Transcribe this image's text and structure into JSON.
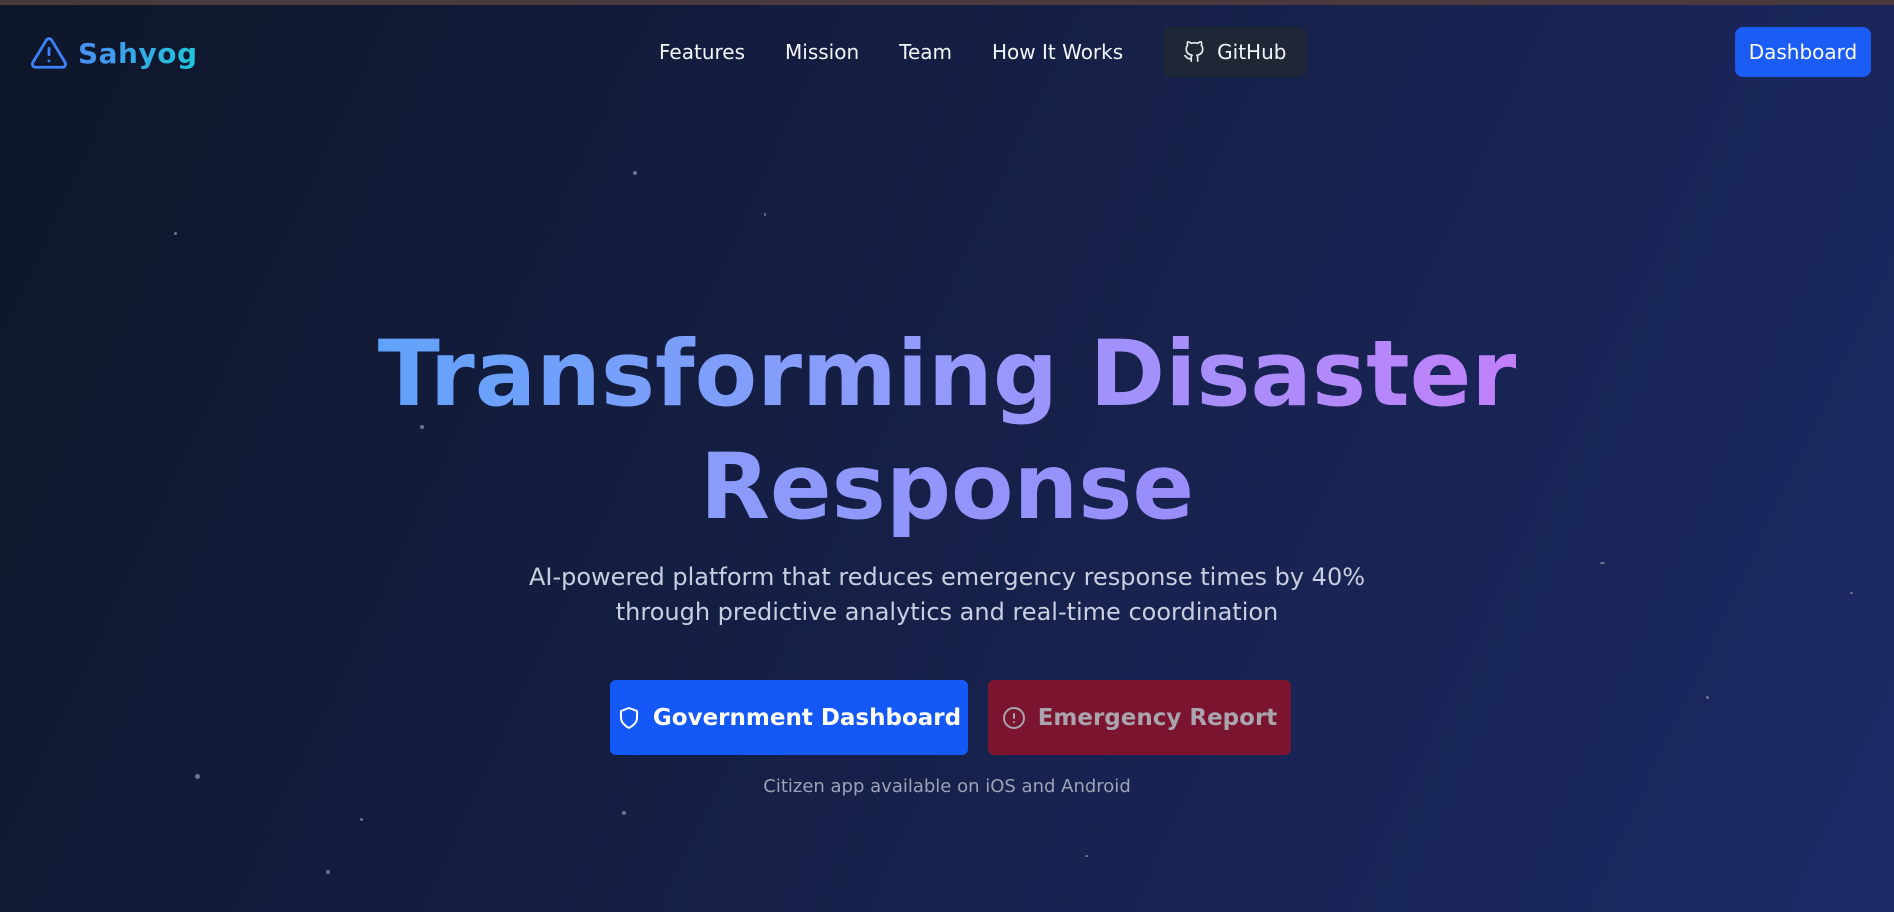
{
  "brand": {
    "name": "Sahyog",
    "icon": "warning-triangle-icon"
  },
  "nav": {
    "links": [
      "Features",
      "Mission",
      "Team",
      "How It Works"
    ],
    "github_label": "GitHub",
    "github_icon": "github-icon",
    "dashboard_label": "Dashboard"
  },
  "hero": {
    "title_line1": "Transforming Disaster",
    "title_line2": "Response",
    "subtitle_line1": "AI-powered platform that reduces emergency response times by 40%",
    "subtitle_line2": "through predictive analytics and real-time coordination",
    "primary_cta": "Government Dashboard",
    "primary_icon": "shield-icon",
    "secondary_cta": "Emergency Report",
    "secondary_icon": "alert-circle-icon",
    "note": "Citizen app available on iOS and Android"
  },
  "colors": {
    "accent_blue": "#1b5cf4",
    "emergency_red": "#7b142e",
    "background": "#151f45"
  }
}
